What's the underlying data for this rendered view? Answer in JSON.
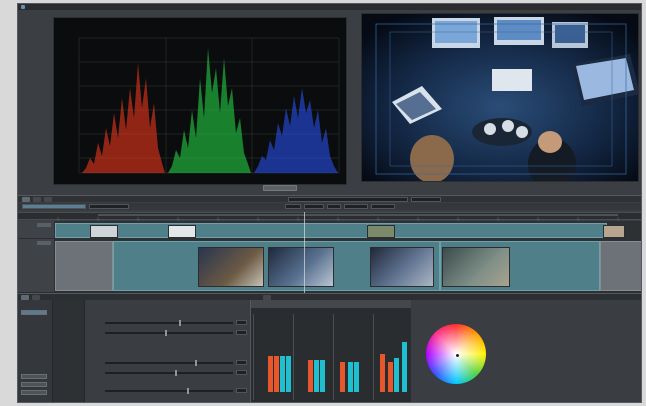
{
  "menubar": {
    "items": [
      "",
      "",
      "",
      "",
      ""
    ]
  },
  "scope": {
    "title": "",
    "axis_labels": [
      "",
      "",
      "",
      "",
      "",
      "",
      ""
    ]
  },
  "toolbar": {
    "tabs": [
      "",
      "",
      ""
    ],
    "fields": [
      "",
      "",
      "",
      ""
    ]
  },
  "timeline": {
    "tracks": [
      "",
      ""
    ]
  },
  "panel_tabs": [
    "",
    "",
    ""
  ],
  "color_wheel": {
    "label": ""
  },
  "colors": {
    "red_channel": "#ff3a1e",
    "green_channel": "#27e04a",
    "blue_channel": "#2b55ff",
    "meter_red": "#e8562c",
    "meter_cyan": "#1fbfd0",
    "clip": "#4f7f88"
  },
  "icons": [
    "app-icon",
    "playhead-icon",
    "color-wheel-icon"
  ]
}
